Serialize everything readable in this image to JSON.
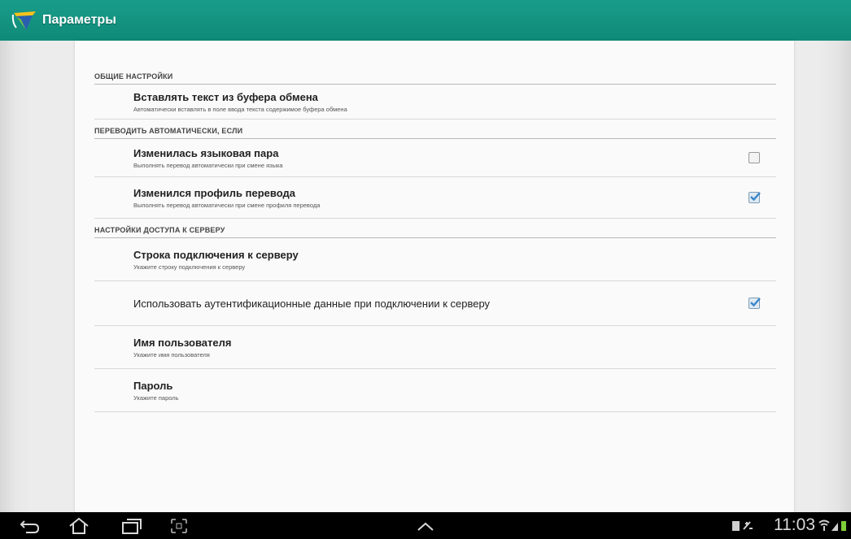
{
  "app": {
    "title": "Параметры"
  },
  "sections": [
    {
      "header": "ОБЩИЕ НАСТРОЙКИ",
      "items": [
        {
          "title": "Вставлять текст из буфера обмена",
          "summary": "Автоматически вставлять в поле ввода текста содержимое буфера обмена"
        }
      ]
    },
    {
      "header": "ПЕРЕВОДИТЬ АВТОМАТИЧЕСКИ, ЕСЛИ",
      "items": [
        {
          "title": "Изменилась языковая пара",
          "summary": "Выполнять перевод автоматически при смене языка",
          "checked": false
        },
        {
          "title": "Изменился профиль перевода",
          "summary": "Выполнять перевод автоматически при смене профиля перевода",
          "checked": true
        }
      ]
    },
    {
      "header": "НАСТРОЙКИ ДОСТУПА К СЕРВЕРУ",
      "items": [
        {
          "title": "Строка подключения к серверу",
          "summary": "Укажите строку подключения к серверу"
        },
        {
          "title": "Использовать аутентификационные данные при подключении к серверу",
          "checked": true
        },
        {
          "title": "Имя пользователя",
          "summary": "Укажите имя пользователя"
        },
        {
          "title": "Пароль",
          "summary": "Укажите пароль"
        }
      ]
    }
  ],
  "status_bar": {
    "time": "11:03"
  },
  "colors": {
    "appbar": "#1a9c8a",
    "accent": "#3a86c8"
  }
}
